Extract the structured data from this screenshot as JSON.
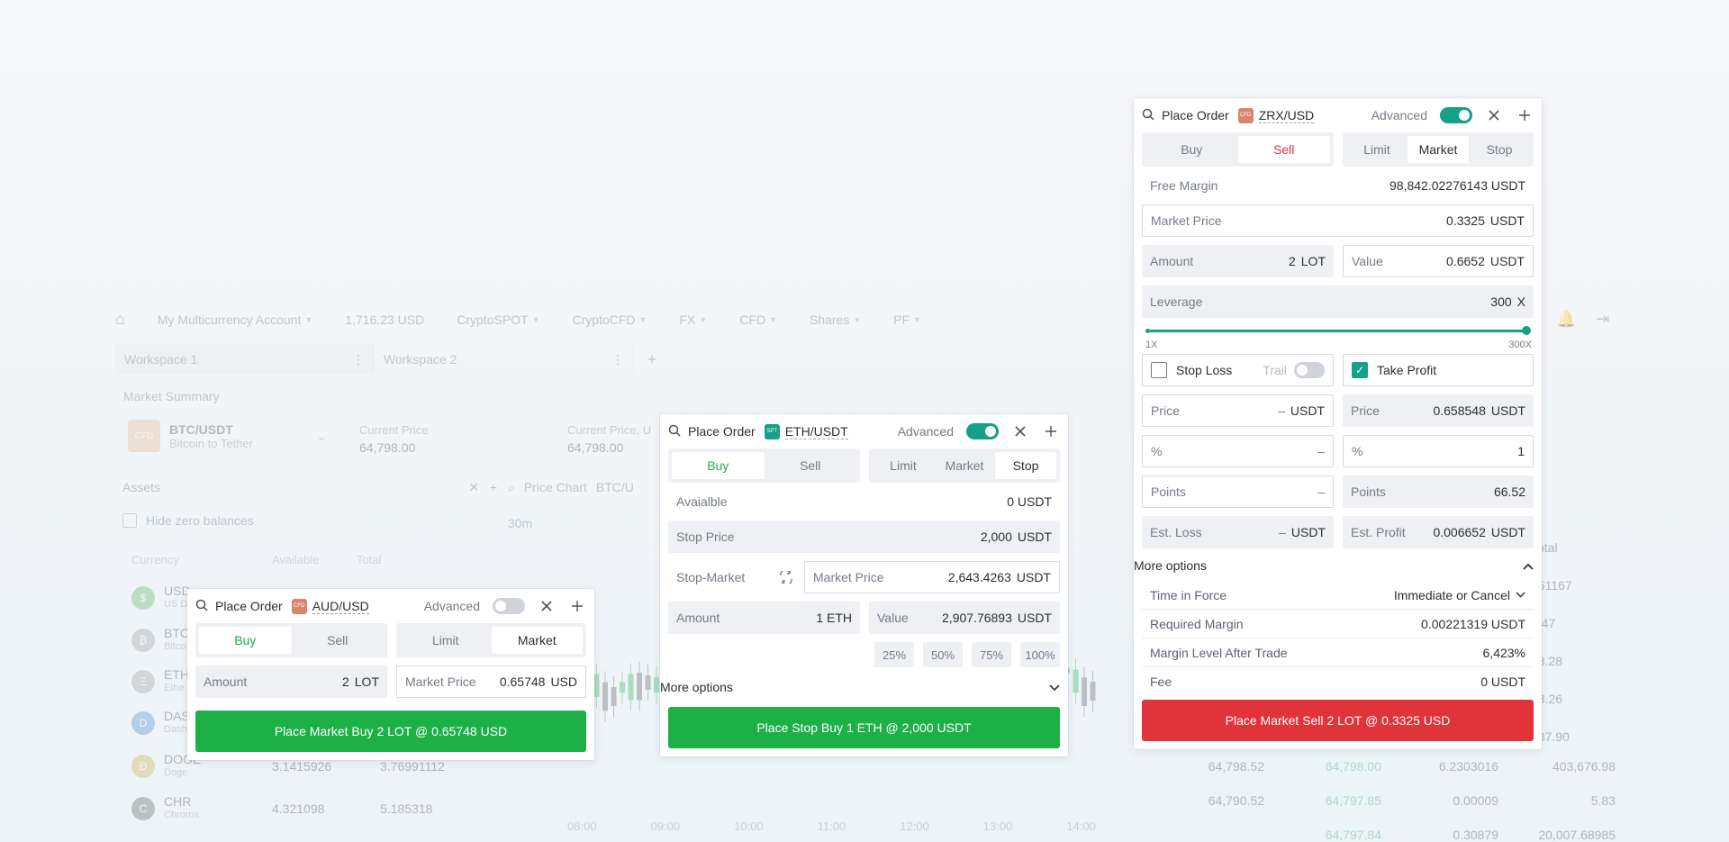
{
  "background": {
    "nav": {
      "account": "My Multicurrency Account",
      "balance": "1,716.23 USD",
      "menus": [
        "CryptoSPOT",
        "CryptoCFD",
        "FX",
        "CFD",
        "Shares",
        "PF"
      ]
    },
    "workspaces": [
      "Workspace 1",
      "Workspace 2"
    ],
    "market_summary": {
      "title": "Market Summary",
      "symbol": "BTC/USDT",
      "symbol_desc": "Bitcoin to Tether",
      "current_price_label": "Current Price",
      "current_price": "64,798.00",
      "current_price_label2": "Current Price, U",
      "current_price2": "64,798.00"
    },
    "assets": {
      "title": "Assets",
      "hide_zero": "Hide zero balances",
      "columns": [
        "Currency",
        "Available",
        "Total"
      ],
      "rows": [
        {
          "code": "USD",
          "name": "US D",
          "available": "",
          "total": ""
        },
        {
          "code": "BTC",
          "name": "Bitco",
          "available": "",
          "total": ""
        },
        {
          "code": "ETH",
          "name": "Ethe",
          "available": "",
          "total": ""
        },
        {
          "code": "DAS",
          "name": "Dash",
          "available": "",
          "total": ""
        },
        {
          "code": "DOGE",
          "name": "Doge",
          "available": "3.1415926",
          "total": "3.76991112"
        },
        {
          "code": "CHR",
          "name": "Chroma",
          "available": "4.321098",
          "total": "5.185318"
        }
      ]
    },
    "chart": {
      "title": "Price Chart",
      "symbol": "BTC/U",
      "interval": "30m",
      "times": [
        "08:00",
        "09:00",
        "10:00",
        "11:00",
        "12:00",
        "13:00",
        "14:00"
      ]
    },
    "book_right": [
      "151167",
      "1.47",
      "68.28",
      "93.26",
      "787.90"
    ],
    "book_right_header": "Total",
    "book_rows": [
      {
        "a": "64,798.00",
        "b": "6.2303016",
        "c": "403,676.98"
      },
      {
        "a": "64,797.85",
        "b": "0.00009",
        "c": "5.83"
      },
      {
        "a": "64,797.84",
        "b": "0.30879",
        "c": "20,007.68985"
      }
    ],
    "book_left": [
      "64,798.52",
      "64,790.52"
    ]
  },
  "panel_audusd": {
    "title": "Place Order",
    "symbol": "AUD/USD",
    "badge": "CFD",
    "badge_color": "#d9856b",
    "advanced_label": "Advanced",
    "advanced_on": false,
    "side_tabs": [
      "Buy",
      "Sell"
    ],
    "type_tabs": [
      "Limit",
      "Market"
    ],
    "amount_label": "Amount",
    "amount_value": "2",
    "amount_unit": "LOT",
    "market_price_label": "Market Price",
    "market_price_value": "0.65748",
    "market_price_unit": "USD",
    "action_label": "Place Market Buy 2 LOT @ 0.65748 USD"
  },
  "panel_ethusdt": {
    "title": "Place Order",
    "symbol": "ETH/USDT",
    "badge": "SPT",
    "badge_color": "#16a085",
    "advanced_label": "Advanced",
    "advanced_on": true,
    "side_tabs": [
      "Buy",
      "Sell"
    ],
    "type_tabs": [
      "Limit",
      "Market",
      "Stop"
    ],
    "available_label": "Avaialble",
    "available_value": "0 USDT",
    "stop_price_label": "Stop Price",
    "stop_price_value": "2,000",
    "stop_price_unit": "USDT",
    "stop_market_label": "Stop-Market",
    "market_price_label": "Market Price",
    "market_price_value": "2,643.4263",
    "market_price_unit": "USDT",
    "amount_label": "Amount",
    "amount_value": "1 ETH",
    "value_label": "Value",
    "value_value": "2,907.76893",
    "value_unit": "USDT",
    "percents": [
      "25%",
      "50%",
      "75%",
      "100%"
    ],
    "more_options": "More options",
    "action_label": "Place Stop Buy 1 ETH @ 2,000 USDT"
  },
  "panel_zrxusd": {
    "title": "Place Order",
    "symbol": "ZRX/USD",
    "badge": "CFD",
    "badge_color": "#d9856b",
    "advanced_label": "Advanced",
    "advanced_on": true,
    "side_tabs": [
      "Buy",
      "Sell"
    ],
    "type_tabs": [
      "Limit",
      "Market",
      "Stop"
    ],
    "free_margin_label": "Free Margin",
    "free_margin_value": "98,842.02276143 USDT",
    "market_price_label": "Market Price",
    "market_price_value": "0.3325",
    "market_price_unit": "USDT",
    "amount_label": "Amount",
    "amount_value": "2",
    "amount_unit": "LOT",
    "value_label": "Value",
    "value_value": "0.6652",
    "value_unit": "USDT",
    "leverage_label": "Leverage",
    "leverage_value": "300",
    "leverage_unit": "X",
    "leverage_min": "1X",
    "leverage_max": "300X",
    "leverage_fraction": 1.0,
    "stop_loss_label": "Stop Loss",
    "trail_label": "Trail",
    "take_profit_label": "Take Profit",
    "sl": {
      "price_label": "Price",
      "price_value": "–",
      "price_unit": "USDT",
      "pct_label": "%",
      "pct_value": "–",
      "points_label": "Points",
      "points_value": "–",
      "est_label": "Est. Loss",
      "est_value": "–",
      "est_unit": "USDT"
    },
    "tp": {
      "price_label": "Price",
      "price_value": "0.658548",
      "price_unit": "USDT",
      "pct_label": "%",
      "pct_value": "1",
      "points_label": "Points",
      "points_value": "66.52",
      "est_label": "Est. Profit",
      "est_value": "0.006652",
      "est_unit": "USDT"
    },
    "more_options": "More options",
    "tif_label": "Time in Force",
    "tif_value": "Immediate or Cancel",
    "req_margin_label": "Required Margin",
    "req_margin_value": "0.00221319 USDT",
    "margin_level_label": "Margin Level After Trade",
    "margin_level_value": "6,423%",
    "fee_label": "Fee",
    "fee_value": "0 USDT",
    "action_label": "Place Market Sell 2 LOT @ 0.3325 USD"
  }
}
